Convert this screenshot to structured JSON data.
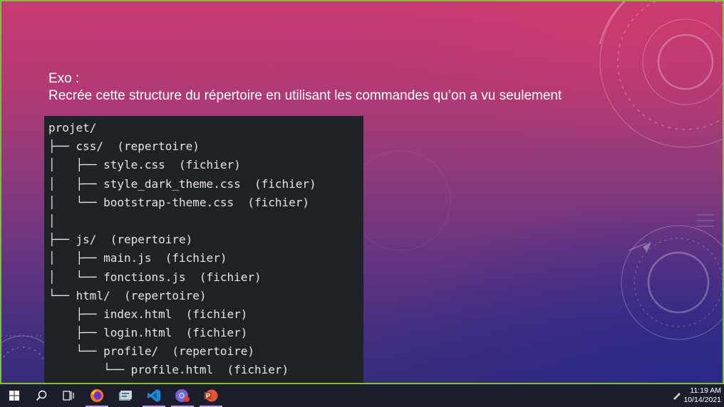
{
  "slide": {
    "title": "Exo :",
    "instruction": "Recrée cette structure du répertoire en utilisant les commandes qu’on a vu seulement",
    "code_lines": [
      "projet/",
      "├── css/  (repertoire)",
      "│   ├── style.css  (fichier)",
      "│   ├── style_dark_theme.css  (fichier)",
      "│   └── bootstrap-theme.css  (fichier)",
      "│",
      "├── js/  (repertoire)",
      "│   ├── main.js  (fichier)",
      "│   └── fonctions.js  (fichier)",
      "└── html/  (repertoire)",
      "    ├── index.html  (fichier)",
      "    ├── login.html  (fichier)",
      "    └── profile/  (repertoire)",
      "        └── profile.html  (fichier)"
    ],
    "colors": {
      "background_top": "#c93a72",
      "background_bottom": "#372c7a",
      "code_background": "#1f2227",
      "code_text": "#e6e6e6",
      "border": "#7bc043"
    }
  },
  "taskbar": {
    "items": [
      {
        "name": "start-button",
        "icon": "windows-logo-icon"
      },
      {
        "name": "search-button",
        "icon": "search-icon"
      },
      {
        "name": "task-view-button",
        "icon": "task-view-icon"
      },
      {
        "name": "firefox-app",
        "icon": "firefox-icon",
        "active": true
      },
      {
        "name": "file-app",
        "icon": "file-app-icon"
      },
      {
        "name": "vscode-app",
        "icon": "vscode-icon",
        "active": true
      },
      {
        "name": "chrome-app",
        "icon": "chrome-icon",
        "active": true
      },
      {
        "name": "powerpoint-app",
        "icon": "powerpoint-icon",
        "active": true
      }
    ],
    "tray_icon": "pen-icon",
    "clock": {
      "time": "11:19 AM",
      "date": "10/14/2021"
    }
  }
}
